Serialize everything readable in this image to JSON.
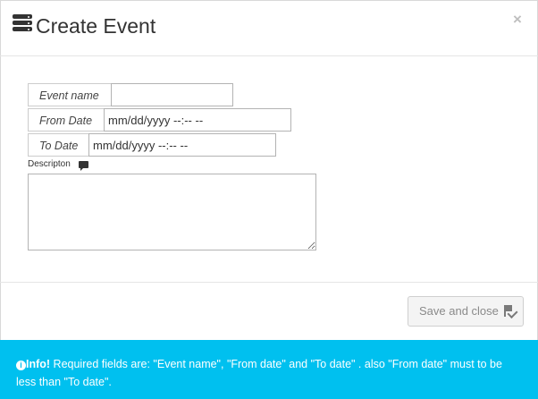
{
  "modal": {
    "title": "Create Event",
    "close_label": "×"
  },
  "form": {
    "event_name_label": "Event name",
    "event_name_value": "",
    "from_date_label": "From Date",
    "from_date_placeholder": "mm/dd/yyyy --:-- --",
    "to_date_label": "To Date",
    "to_date_placeholder": "mm/dd/yyyy --:-- --",
    "description_label": "Descripton",
    "description_value": ""
  },
  "footer": {
    "save_label": "Save and close"
  },
  "alert": {
    "prefix": "Info!",
    "message": " Required fields are: \"Event name\", \"From date\" and \"To date\" . also \"From date\" must to be less than \"To date\"."
  },
  "icons": {
    "title_icon": "server-icon",
    "description_icon": "comment-icon",
    "save_icon": "flag-check-icon",
    "alert_icon": "info-circle-icon"
  },
  "colors": {
    "alert_bg": "#00c0ef",
    "title_text": "#333333",
    "button_bg": "#f4f4f4"
  }
}
